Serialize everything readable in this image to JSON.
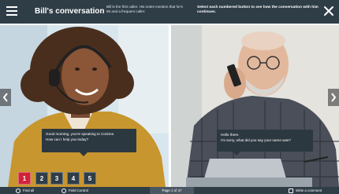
{
  "header": {
    "title": "Bill's conversation",
    "description": "Bill is the first caller. His notes mention that he's 85 and a frequent caller.",
    "instruction": "Select each numbered button to see how the conversation with him continues."
  },
  "bubbles": {
    "agent": {
      "line1": "Good morning, you're speaking to Corinne.",
      "line2": "How can I help you today?"
    },
    "caller": {
      "line1": "Hello there.",
      "line2": "I'm sorry, what did you say your name was?"
    }
  },
  "steps": [
    {
      "label": "1",
      "active": true
    },
    {
      "label": "2",
      "active": false
    },
    {
      "label": "3",
      "active": false
    },
    {
      "label": "4",
      "active": false
    },
    {
      "label": "5",
      "active": false
    }
  ],
  "footer": {
    "find_all": "Find all",
    "field_control": "Field Control",
    "page_indicator": "Page 1 of 47",
    "write_comment": "Write a comment"
  },
  "colors": {
    "bar": "#2f3d47",
    "active_step": "#d0233a",
    "bubble": "#2c3840"
  },
  "icons": [
    "menu-icon",
    "close-icon",
    "chevron-left-icon",
    "chevron-right-icon",
    "search-icon",
    "settings-icon",
    "comment-icon"
  ]
}
